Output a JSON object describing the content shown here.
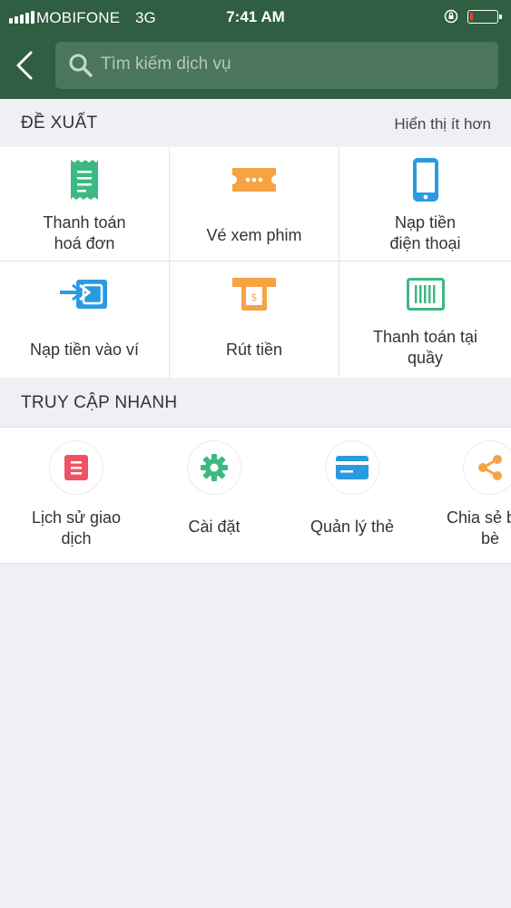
{
  "status_bar": {
    "carrier": "MOBIFONE",
    "network": "3G",
    "time": "7:41 AM"
  },
  "header": {
    "search_placeholder": "Tìm kiếm dịch vụ"
  },
  "suggest": {
    "title": "ĐỀ XUẤT",
    "action": "Hiển thị ít hơn",
    "items": [
      {
        "line1": "Thanh toán",
        "line2": "hoá đơn",
        "icon": "bill-icon"
      },
      {
        "line1": "Vé xem phim",
        "line2": "",
        "icon": "ticket-icon"
      },
      {
        "line1": "Nạp tiền",
        "line2": "điện thoại",
        "icon": "phone-icon"
      },
      {
        "line1": "Nạp tiền vào ví",
        "line2": "",
        "icon": "wallet-topup-icon"
      },
      {
        "line1": "Rút tiền",
        "line2": "",
        "icon": "atm-withdraw-icon"
      },
      {
        "line1": "Thanh toán tại",
        "line2": "quầy",
        "icon": "barcode-icon"
      }
    ]
  },
  "quick": {
    "title": "TRUY CẬP NHANH",
    "items": [
      {
        "line1": "Lịch sử giao",
        "line2": "dịch",
        "icon": "history-icon"
      },
      {
        "line1": "Cài đặt",
        "line2": "",
        "icon": "gear-icon"
      },
      {
        "line1": "Quản lý thẻ",
        "line2": "",
        "icon": "card-icon"
      },
      {
        "line1": "Chia sẻ bạn",
        "line2": "bè",
        "icon": "share-icon"
      }
    ]
  },
  "colors": {
    "header_bg": "#2f5e42",
    "search_bg": "#4b765c",
    "green": "#3cb982",
    "orange": "#f5a343",
    "blue": "#2a9be0",
    "red": "#f05264"
  }
}
